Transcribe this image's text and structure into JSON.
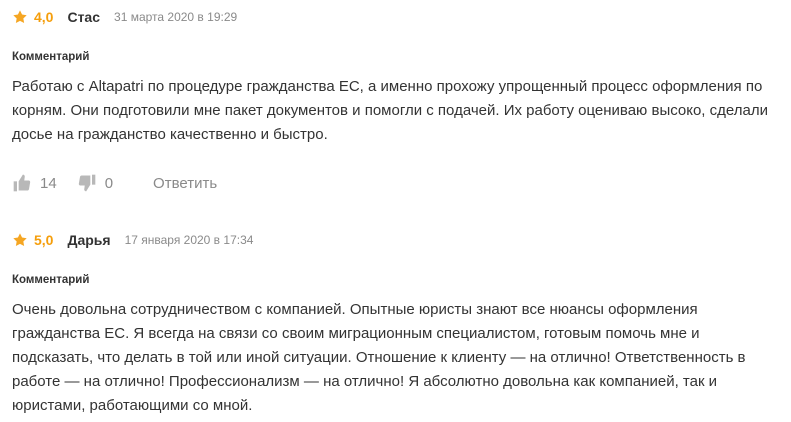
{
  "colors": {
    "star": "#f5a623",
    "text": "#333333",
    "muted": "#8a8a8a",
    "icon": "#b8b8b8"
  },
  "reviews": [
    {
      "rating": "4,0",
      "author": "Стас",
      "date": "31 марта 2020 в 19:29",
      "comment_label": "Комментарий",
      "text": "Работаю с Altapatri по процедуре гражданства ЕС, а именно прохожу упрощенный процесс оформления по корням. Они подготовили мне пакет документов и помогли с подачей. Их работу оцениваю высоко, сделали досье на гражданство качественно и быстро.",
      "likes": "14",
      "dislikes": "0",
      "reply_label": "Ответить"
    },
    {
      "rating": "5,0",
      "author": "Дарья",
      "date": "17 января 2020 в 17:34",
      "comment_label": "Комментарий",
      "text": "Очень довольна сотрудничеством с компанией. Опытные юристы знают все нюансы оформления гражданства ЕС. Я всегда на связи со своим миграционным специалистом, готовым помочь мне и подсказать, что делать в той или иной ситуации. Отношение к клиенту — на отлично! Ответственность в работе — на отлично! Профессионализм — на отлично! Я абсолютно довольна как компанией, так и юристами, работающими со мной."
    }
  ]
}
